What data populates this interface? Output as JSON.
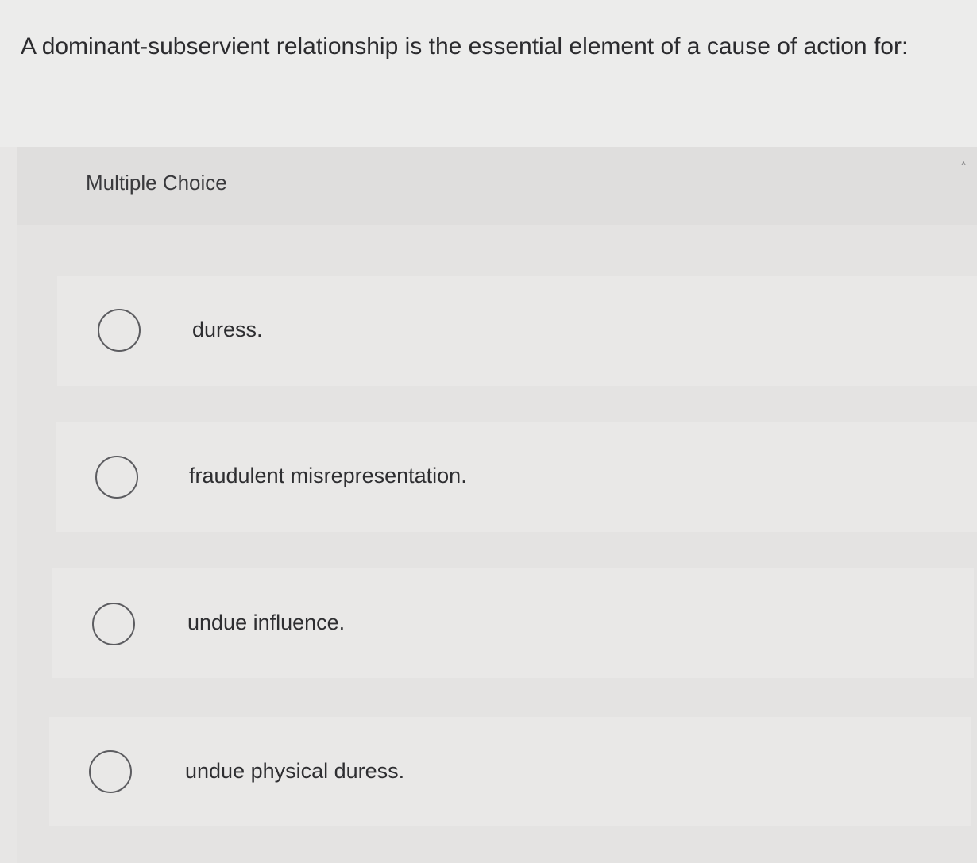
{
  "question": {
    "text": "A dominant-subservient relationship is the essential element of a cause of action for:"
  },
  "panel": {
    "type_label": "Multiple Choice",
    "collapse_glyph": "˄"
  },
  "choices": [
    {
      "label": "duress."
    },
    {
      "label": "fraudulent misrepresentation."
    },
    {
      "label": "undue influence."
    },
    {
      "label": "undue physical duress."
    }
  ],
  "colors": {
    "page_background": "#e7e6e5",
    "choice_background": "#e9e8e7",
    "text": "#2f2f32",
    "radio_border": "#5c5c60"
  }
}
